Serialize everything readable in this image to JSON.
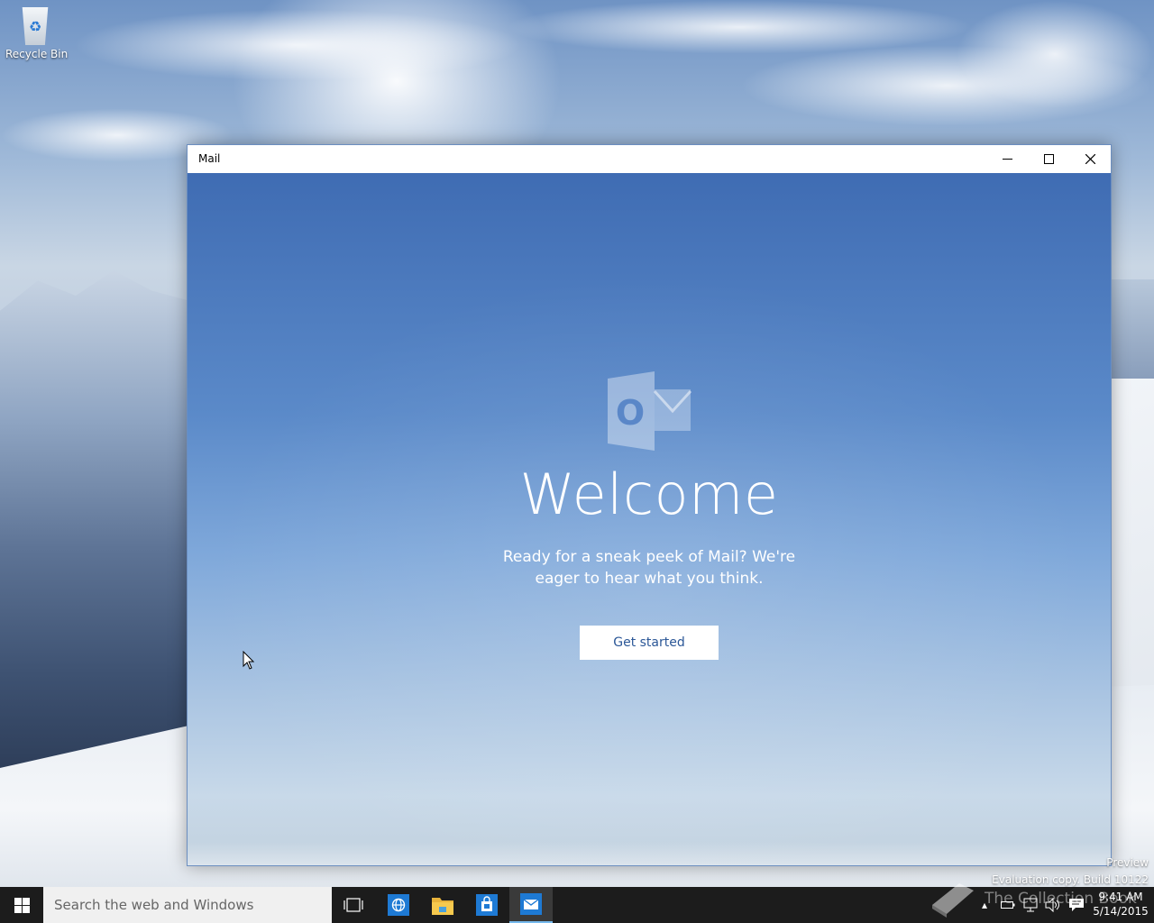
{
  "desktop": {
    "recycle_bin_label": "Recycle Bin",
    "watermark_line1": "Preview",
    "watermark_line2": "Evaluation copy. Build 10122",
    "overlay_brand": "The Collection Book"
  },
  "window": {
    "title": "Mail",
    "minimize_icon": "minimize-icon",
    "maximize_icon": "maximize-icon",
    "close_icon": "close-icon"
  },
  "welcome": {
    "logo_icon": "outlook-logo-icon",
    "logo_letter": "O",
    "heading": "Welcome",
    "subtitle_line1": "Ready for a sneak peek of Mail? We're",
    "subtitle_line2": "eager to hear what you think.",
    "button_label": "Get started"
  },
  "taskbar": {
    "search_placeholder": "Search the web and Windows",
    "apps": [
      "task-view-icon",
      "internet-explorer-icon",
      "file-explorer-icon",
      "store-icon",
      "mail-icon"
    ],
    "time": "9:41 AM",
    "date": "5/14/2015"
  },
  "colors": {
    "accent": "#2b5797",
    "taskbar": "#1c1c1c",
    "active_indicator": "#76b9ed"
  }
}
